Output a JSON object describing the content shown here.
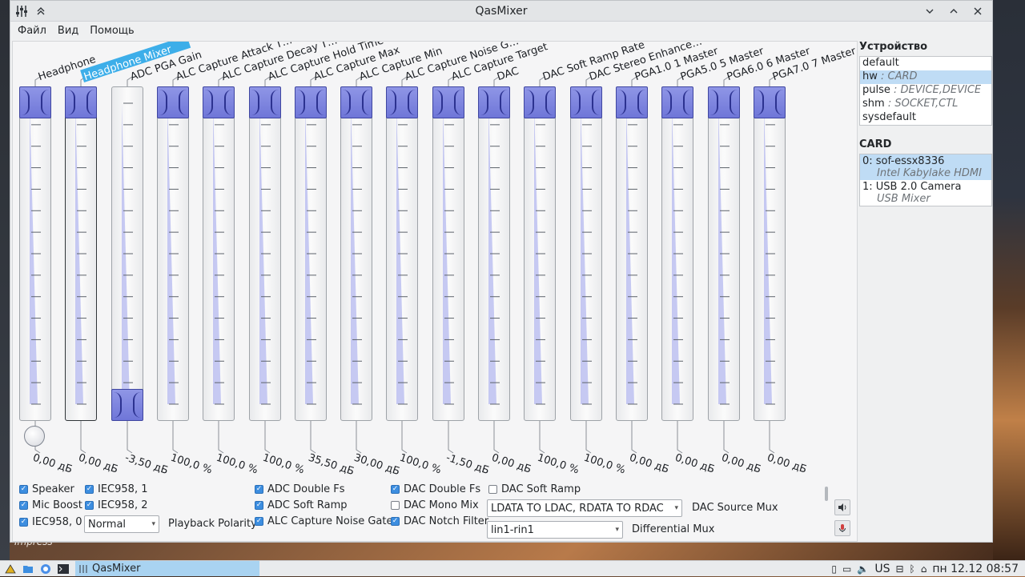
{
  "window": {
    "title": "QasMixer"
  },
  "menu": [
    "Файл",
    "Вид",
    "Помощь"
  ],
  "desktop_label": "Impress",
  "sliders": [
    {
      "name": "Headphone",
      "value": "0,00 дБ",
      "level": 1.0,
      "has_knob": true
    },
    {
      "name": "Headphone Mixer",
      "value": "0,00 дБ",
      "level": 1.0,
      "highlighted": true,
      "focused": true
    },
    {
      "name": "ADC PGA Gain",
      "value": "-3,50 дБ",
      "level": 0.0
    },
    {
      "name": "ALC Capture Attack T…",
      "value": "100,0 %",
      "level": 1.0
    },
    {
      "name": "ALC Capture Decay T…",
      "value": "100,0 %",
      "level": 1.0
    },
    {
      "name": "ALC Capture Hold Time",
      "value": "100,0 %",
      "level": 1.0
    },
    {
      "name": "ALC Capture Max",
      "value": "35,50 дБ",
      "level": 1.0
    },
    {
      "name": "ALC Capture Min",
      "value": "30,00 дБ",
      "level": 1.0
    },
    {
      "name": "ALC Capture Noise G…",
      "value": "100,0 %",
      "level": 1.0
    },
    {
      "name": "ALC Capture Target",
      "value": "-1,50 дБ",
      "level": 1.0
    },
    {
      "name": "DAC",
      "value": "0,00 дБ",
      "level": 1.0
    },
    {
      "name": "DAC Soft Ramp Rate",
      "value": "100,0 %",
      "level": 1.0
    },
    {
      "name": "DAC Stereo Enhance…",
      "value": "100,0 %",
      "level": 1.0
    },
    {
      "name": "PGA1.0 1 Master",
      "value": "0,00 дБ",
      "level": 1.0
    },
    {
      "name": "PGA5.0 5 Master",
      "value": "0,00 дБ",
      "level": 1.0
    },
    {
      "name": "PGA6.0 6 Master",
      "value": "0,00 дБ",
      "level": 1.0
    },
    {
      "name": "PGA7.0 7 Master",
      "value": "0,00 дБ",
      "level": 1.0
    }
  ],
  "checkboxes": [
    {
      "label": "Speaker",
      "checked": true
    },
    {
      "label": "Mic Boost",
      "checked": true
    },
    {
      "label": "IEC958, 0",
      "checked": true
    },
    {
      "label": "IEC958, 1",
      "checked": true
    },
    {
      "label": "IEC958, 2",
      "checked": true
    },
    {
      "label": "ADC Double Fs",
      "checked": true
    },
    {
      "label": "ADC Soft Ramp",
      "checked": true
    },
    {
      "label": "ALC Capture Noise Gate",
      "checked": true
    },
    {
      "label": "DAC Double Fs",
      "checked": true
    },
    {
      "label": "DAC Mono Mix",
      "checked": false
    },
    {
      "label": "DAC Notch Filter",
      "checked": true
    },
    {
      "label": "DAC Soft Ramp",
      "checked": false
    }
  ],
  "playback_polarity": {
    "value": "Normal",
    "label": "Playback Polarity"
  },
  "dac_source_mux": {
    "value": "LDATA TO LDAC, RDATA TO RDAC",
    "label": "DAC Source Mux"
  },
  "differential_mux": {
    "value": "lin1-rin1",
    "label": "Differential Mux"
  },
  "device_panel": {
    "title": "Устройство",
    "items": [
      {
        "name": "default",
        "desc": ""
      },
      {
        "name": "hw",
        "desc": ": CARD",
        "selected": true
      },
      {
        "name": "pulse",
        "desc": ": DEVICE,DEVICE"
      },
      {
        "name": "shm",
        "desc": ": SOCKET,CTL"
      },
      {
        "name": "sysdefault",
        "desc": ""
      }
    ]
  },
  "card_panel": {
    "title": "CARD",
    "items": [
      {
        "index": "0:",
        "name": "sof-essx8336",
        "sub": "Intel Kabylake HDMI",
        "selected": true
      },
      {
        "index": "1:",
        "name": "USB 2.0 Camera",
        "sub": "USB Mixer"
      }
    ]
  },
  "taskbar": {
    "task": "QasMixer",
    "keyboard_layout": "US",
    "clock": "пн 12.12 08:57"
  },
  "colors": {
    "handle": "#7b82de",
    "selection": "#bfdcf5",
    "checkbox": "#3d8ee0",
    "highlight_label": "#3daee9"
  }
}
